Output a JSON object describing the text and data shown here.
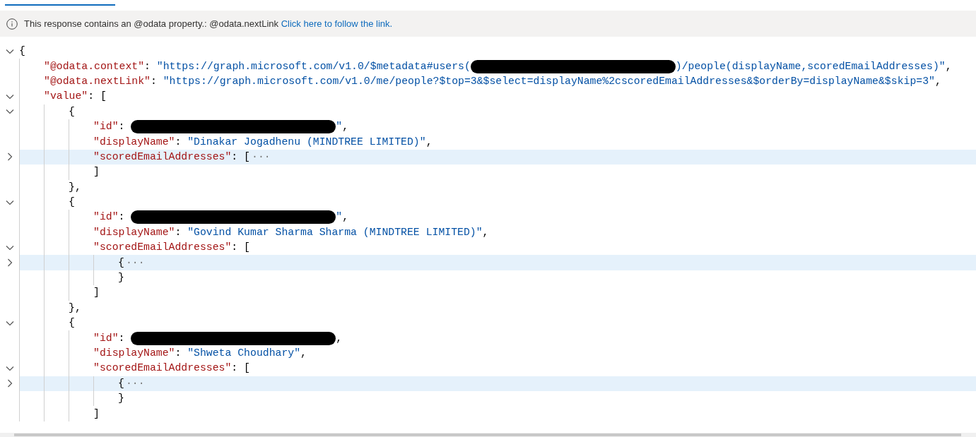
{
  "info_bar": {
    "message": "This response contains an @odata property.: @odata.nextLink",
    "link": "Click here to follow the link."
  },
  "document": {
    "expanded": true,
    "highlighted": false,
    "tokens": [
      {
        "kind": "punct",
        "text": "{"
      }
    ],
    "children": [
      {
        "highlighted": false,
        "tokens": [
          {
            "kind": "key",
            "text": "\"@odata.context\""
          },
          {
            "kind": "punct",
            "text": ": "
          },
          {
            "kind": "string",
            "text": "\"https://graph.microsoft.com/v1.0/$metadata#users("
          },
          {
            "kind": "redaction"
          },
          {
            "kind": "string",
            "text": ")/people(displayName,scoredEmailAddresses)\""
          },
          {
            "kind": "punct",
            "text": ","
          }
        ]
      },
      {
        "highlighted": false,
        "tokens": [
          {
            "kind": "key",
            "text": "\"@odata.nextLink\""
          },
          {
            "kind": "punct",
            "text": ": "
          },
          {
            "kind": "string",
            "text": "\"https://graph.microsoft.com/v1.0/me/people?$top=3&$select=displayName%2cscoredEmailAddresses&$orderBy=displayName&$skip=3\""
          },
          {
            "kind": "punct",
            "text": ","
          }
        ]
      },
      {
        "expanded": true,
        "highlighted": false,
        "tokens": [
          {
            "kind": "key",
            "text": "\"value\""
          },
          {
            "kind": "punct",
            "text": ": ["
          }
        ],
        "children": [
          {
            "expanded": true,
            "highlighted": false,
            "tokens": [
              {
                "kind": "punct",
                "text": "{"
              }
            ],
            "children": [
              {
                "highlighted": false,
                "tokens": [
                  {
                    "kind": "key",
                    "text": "\"id\""
                  },
                  {
                    "kind": "punct",
                    "text": ": "
                  },
                  {
                    "kind": "redaction"
                  },
                  {
                    "kind": "string",
                    "text": "\""
                  },
                  {
                    "kind": "punct",
                    "text": ","
                  }
                ]
              },
              {
                "highlighted": false,
                "tokens": [
                  {
                    "kind": "key",
                    "text": "\"displayName\""
                  },
                  {
                    "kind": "punct",
                    "text": ": "
                  },
                  {
                    "kind": "string",
                    "text": "\"Dinakar Jogadhenu (MINDTREE LIMITED)\""
                  },
                  {
                    "kind": "punct",
                    "text": ","
                  }
                ]
              },
              {
                "expanded": false,
                "highlighted": true,
                "tokens": [
                  {
                    "kind": "key",
                    "text": "\"scoredEmailAddresses\""
                  },
                  {
                    "kind": "punct",
                    "text": ": ["
                  },
                  {
                    "kind": "ellipsis",
                    "text": "···"
                  }
                ],
                "closing": [
                  {
                    "kind": "punct",
                    "text": "]"
                  }
                ]
              }
            ],
            "closing": [
              {
                "kind": "punct",
                "text": "},"
              }
            ]
          },
          {
            "expanded": true,
            "highlighted": false,
            "tokens": [
              {
                "kind": "punct",
                "text": "{"
              }
            ],
            "children": [
              {
                "highlighted": false,
                "tokens": [
                  {
                    "kind": "key",
                    "text": "\"id\""
                  },
                  {
                    "kind": "punct",
                    "text": ": "
                  },
                  {
                    "kind": "redaction"
                  },
                  {
                    "kind": "string",
                    "text": "\""
                  },
                  {
                    "kind": "punct",
                    "text": ","
                  }
                ]
              },
              {
                "highlighted": false,
                "tokens": [
                  {
                    "kind": "key",
                    "text": "\"displayName\""
                  },
                  {
                    "kind": "punct",
                    "text": ": "
                  },
                  {
                    "kind": "string",
                    "text": "\"Govind Kumar Sharma Sharma (MINDTREE LIMITED)\""
                  },
                  {
                    "kind": "punct",
                    "text": ","
                  }
                ]
              },
              {
                "expanded": true,
                "highlighted": false,
                "tokens": [
                  {
                    "kind": "key",
                    "text": "\"scoredEmailAddresses\""
                  },
                  {
                    "kind": "punct",
                    "text": ": ["
                  }
                ],
                "children": [
                  {
                    "expanded": false,
                    "highlighted": true,
                    "tokens": [
                      {
                        "kind": "punct",
                        "text": "{"
                      },
                      {
                        "kind": "ellipsis",
                        "text": "···"
                      }
                    ],
                    "closing": [
                      {
                        "kind": "punct",
                        "text": "}"
                      }
                    ]
                  }
                ],
                "closing": [
                  {
                    "kind": "punct",
                    "text": "]"
                  }
                ]
              }
            ],
            "closing": [
              {
                "kind": "punct",
                "text": "},"
              }
            ]
          },
          {
            "expanded": true,
            "highlighted": false,
            "tokens": [
              {
                "kind": "punct",
                "text": "{"
              }
            ],
            "children": [
              {
                "highlighted": false,
                "tokens": [
                  {
                    "kind": "key",
                    "text": "\"id\""
                  },
                  {
                    "kind": "punct",
                    "text": ": "
                  },
                  {
                    "kind": "redaction"
                  },
                  {
                    "kind": "punct",
                    "text": ","
                  }
                ]
              },
              {
                "highlighted": false,
                "tokens": [
                  {
                    "kind": "key",
                    "text": "\"displayName\""
                  },
                  {
                    "kind": "punct",
                    "text": ": "
                  },
                  {
                    "kind": "string",
                    "text": "\"Shweta Choudhary\""
                  },
                  {
                    "kind": "punct",
                    "text": ","
                  }
                ]
              },
              {
                "expanded": true,
                "highlighted": false,
                "tokens": [
                  {
                    "kind": "key",
                    "text": "\"scoredEmailAddresses\""
                  },
                  {
                    "kind": "punct",
                    "text": ": ["
                  }
                ],
                "children": [
                  {
                    "expanded": false,
                    "highlighted": true,
                    "tokens": [
                      {
                        "kind": "punct",
                        "text": "{"
                      },
                      {
                        "kind": "ellipsis",
                        "text": "···"
                      }
                    ],
                    "closing": [
                      {
                        "kind": "punct",
                        "text": "}"
                      }
                    ]
                  }
                ],
                "closing": [
                  {
                    "kind": "punct",
                    "text": "]"
                  }
                ]
              }
            ]
          }
        ]
      }
    ]
  }
}
